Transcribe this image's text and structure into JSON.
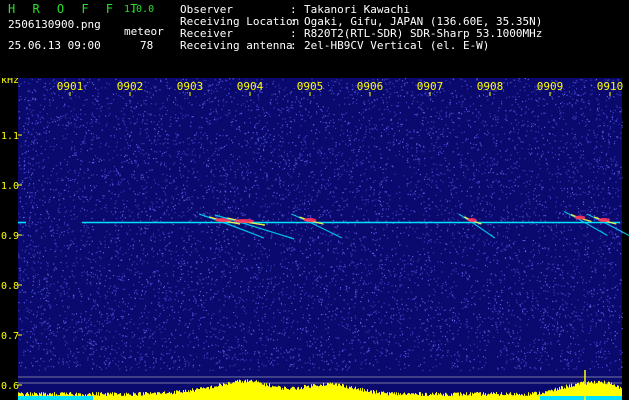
{
  "header": {
    "app_name": "H R O F F T",
    "version": "1.0.0",
    "filename": "2506130900.png",
    "datetime": "25.06.13 09:00",
    "detection_label": "meteor",
    "detection_count": "78",
    "info": [
      {
        "key": "Observer",
        "value": "Takanori Kawachi"
      },
      {
        "key": "Receiving Location",
        "value": "Ogaki, Gifu, JAPAN (136.60E, 35.35N)"
      },
      {
        "key": "Receiver",
        "value": "R820T2(RTL-SDR) SDR-Sharp 53.1000MHz"
      },
      {
        "key": "Receiving antenna",
        "value": "2el-HB9CV Vertical (el. E-W)"
      }
    ]
  },
  "colors": {
    "background": "#000000",
    "spectrogram_bg": "#0a0a6e",
    "noise": "#4a4ad8",
    "carrier": "#00e0ff",
    "meteor_hot": "#ff3060",
    "meteor_warm": "#ffff40",
    "axis_text": "#ffff00",
    "power_bar": "#ffff00",
    "power_base": "#00e0ff"
  },
  "chart_data": {
    "type": "heatmap",
    "y_unit": "kHz",
    "y_ticks": [
      "1.1",
      "1.0",
      "0.9",
      "0.8",
      "0.7",
      "0.6"
    ],
    "y_tick_values": [
      1.1,
      1.0,
      0.9,
      0.8,
      0.7,
      0.6
    ],
    "ylim": [
      0.58,
      1.2
    ],
    "x_ticks": [
      "0901",
      "0902",
      "0903",
      "0904",
      "0905",
      "0906",
      "0907",
      "0908",
      "0909",
      "0910"
    ],
    "xlim_minutes": [
      0,
      10
    ],
    "carrier_khz": 0.925,
    "meteor_events": [
      {
        "minute": 2.55,
        "khz": 0.93,
        "length": 1.8
      },
      {
        "minute": 2.9,
        "khz": 0.928,
        "length": 2.2
      },
      {
        "minute": 4.0,
        "khz": 0.93,
        "length": 1.4
      },
      {
        "minute": 6.7,
        "khz": 0.93,
        "length": 1.0
      },
      {
        "minute": 8.5,
        "khz": 0.935,
        "length": 1.2
      },
      {
        "minute": 8.9,
        "khz": 0.93,
        "length": 1.3
      }
    ]
  }
}
